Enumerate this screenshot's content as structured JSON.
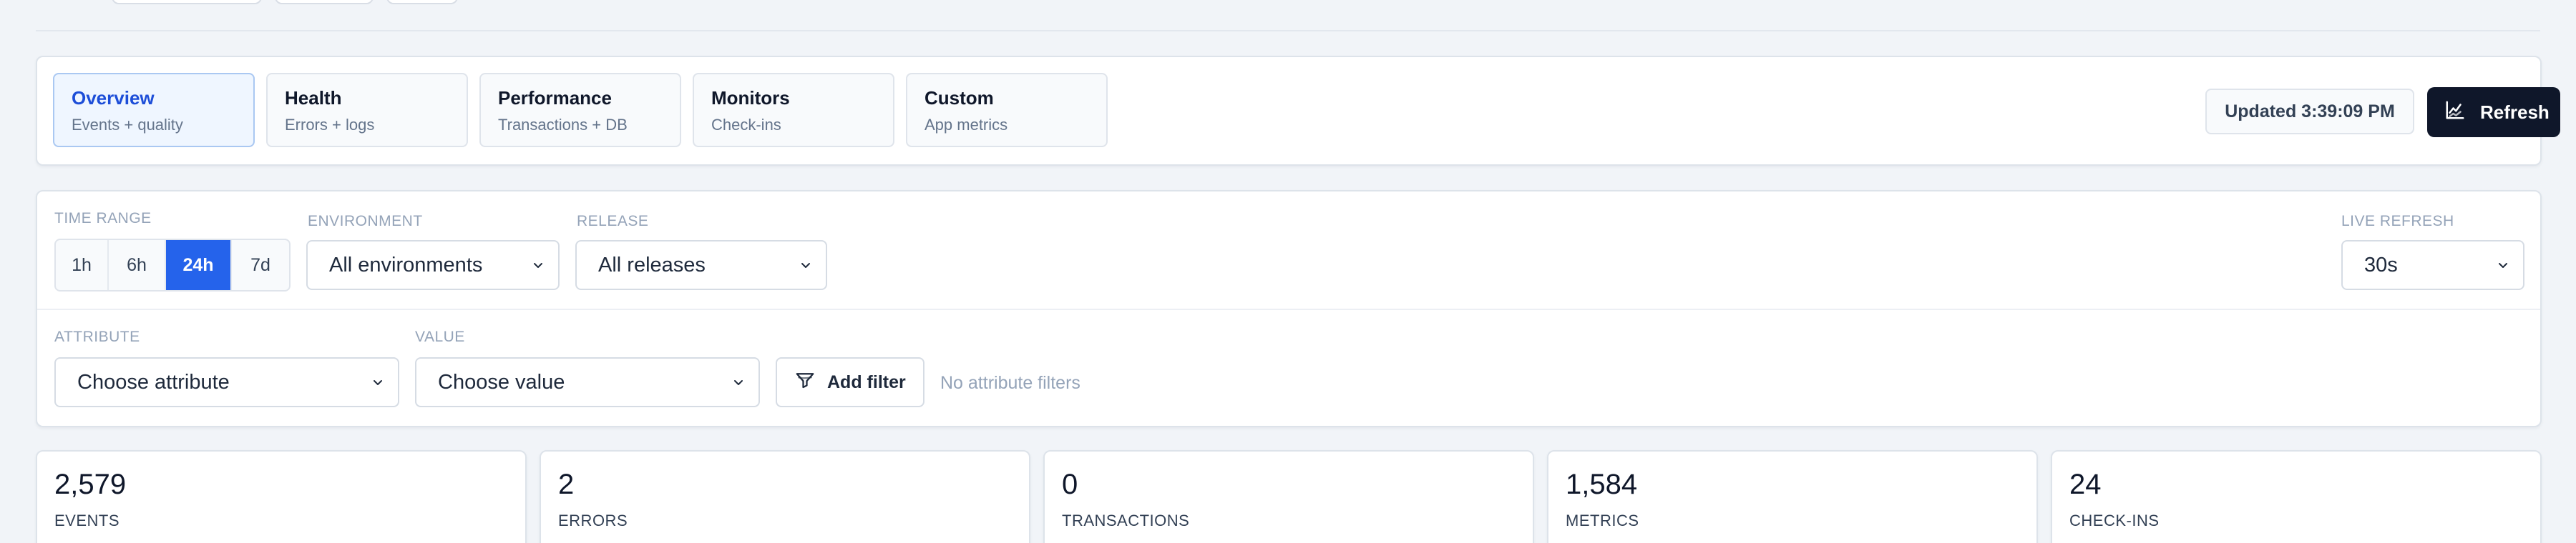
{
  "tabs": [
    {
      "title": "Overview",
      "subtitle": "Events + quality",
      "active": true
    },
    {
      "title": "Health",
      "subtitle": "Errors + logs",
      "active": false
    },
    {
      "title": "Performance",
      "subtitle": "Transactions + DB",
      "active": false
    },
    {
      "title": "Monitors",
      "subtitle": "Check-ins",
      "active": false
    },
    {
      "title": "Custom",
      "subtitle": "App metrics",
      "active": false
    }
  ],
  "header": {
    "updated_text": "Updated 3:39:09 PM",
    "refresh_label": "Refresh",
    "refresh_icon": "chart-line-icon"
  },
  "filters": {
    "time_range_label": "TIME RANGE",
    "time_ranges": [
      "1h",
      "6h",
      "24h",
      "7d"
    ],
    "time_range_selected": "24h",
    "environment_label": "ENVIRONMENT",
    "environment_value": "All environments",
    "release_label": "RELEASE",
    "release_value": "All releases",
    "live_refresh_label": "LIVE REFRESH",
    "live_refresh_value": "30s",
    "attribute_label": "ATTRIBUTE",
    "attribute_value": "Choose attribute",
    "value_label": "VALUE",
    "value_value": "Choose value",
    "add_filter_label": "Add filter",
    "add_filter_icon": "funnel-icon",
    "no_filters_text": "No attribute filters"
  },
  "stats": [
    {
      "value": "2,579",
      "label": "EVENTS"
    },
    {
      "value": "2",
      "label": "ERRORS"
    },
    {
      "value": "0",
      "label": "TRANSACTIONS"
    },
    {
      "value": "1,584",
      "label": "METRICS"
    },
    {
      "value": "24",
      "label": "CHECK-INS"
    }
  ],
  "colors": {
    "accent": "#2563eb",
    "active_tab_text": "#1d4ed8",
    "dark_button": "#0f172a",
    "background": "#f1f4f8"
  }
}
